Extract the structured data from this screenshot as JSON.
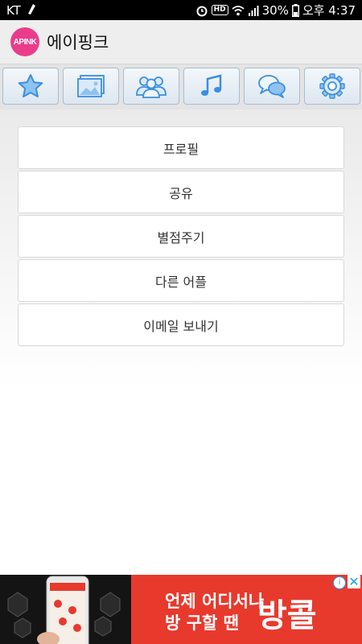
{
  "status_bar": {
    "carrier": "KT",
    "battery": "30%",
    "time": "오후 4:37",
    "hd": "HD"
  },
  "app": {
    "logo_text": "APINK",
    "title": "에이핑크"
  },
  "tabs": [
    {
      "icon": "star-icon"
    },
    {
      "icon": "image-icon"
    },
    {
      "icon": "people-icon"
    },
    {
      "icon": "music-icon"
    },
    {
      "icon": "chat-icon"
    },
    {
      "icon": "gear-icon"
    }
  ],
  "menu": [
    {
      "label": "프로필"
    },
    {
      "label": "공유"
    },
    {
      "label": "별점주기"
    },
    {
      "label": "다른 어플"
    },
    {
      "label": "이메일 보내기"
    }
  ],
  "ad": {
    "line1": "언제 어디서나",
    "line2": "방 구할 땐",
    "brand": "방콜"
  },
  "colors": {
    "logo": "#ea3c8a",
    "tab_icon": "#3a8fe0",
    "ad_red": "#e8392d"
  }
}
